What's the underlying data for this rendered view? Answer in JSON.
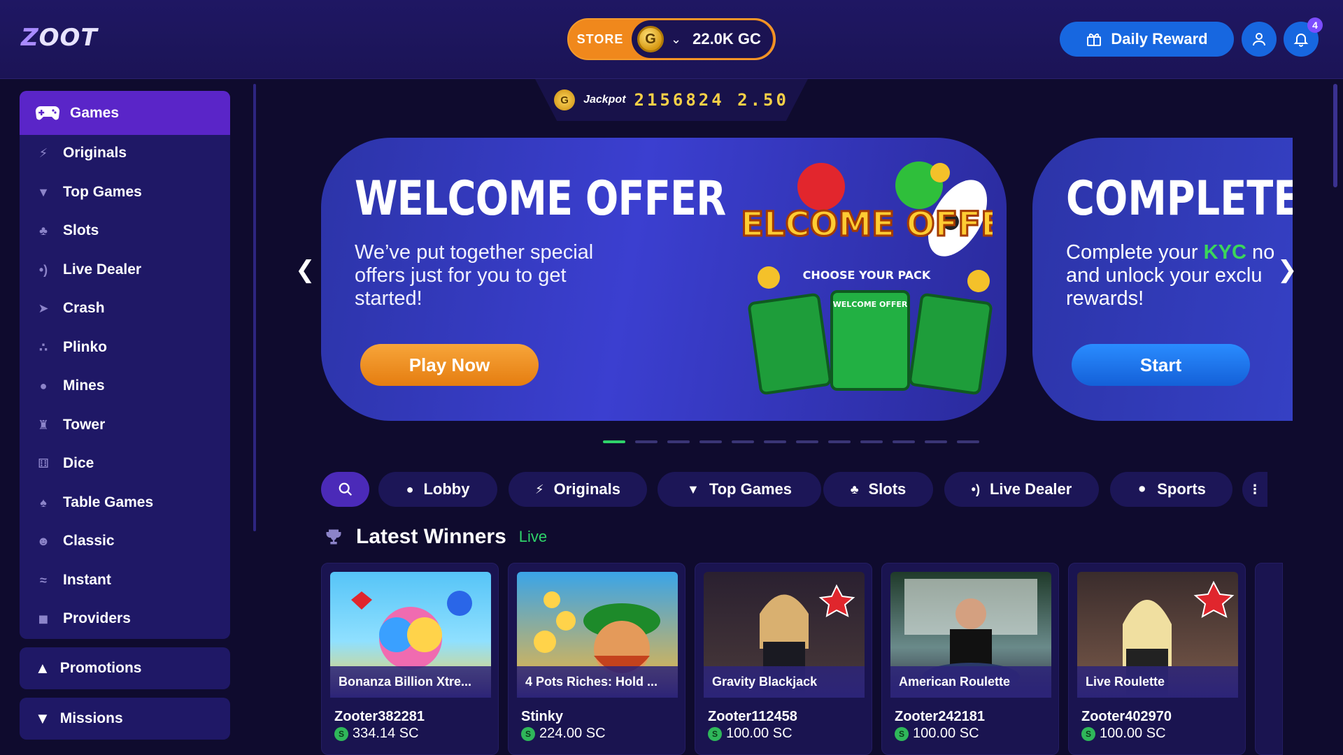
{
  "header": {
    "logo": "ZOOT",
    "store_label": "STORE",
    "balance": "22.0K GC",
    "coin_symbol": "G",
    "daily_reward_label": "Daily Reward",
    "notification_count": "4"
  },
  "jackpot": {
    "label": "Jackpot",
    "value": "2156824 2.50",
    "coin_symbol": "G"
  },
  "sidebar": {
    "games_label": "Games",
    "items": [
      {
        "label": "Originals",
        "icon": "bolt-icon"
      },
      {
        "label": "Top Games",
        "icon": "trophy-icon"
      },
      {
        "label": "Slots",
        "icon": "cherries-icon"
      },
      {
        "label": "Live Dealer",
        "icon": "broadcast-icon"
      },
      {
        "label": "Crash",
        "icon": "rocket-icon"
      },
      {
        "label": "Plinko",
        "icon": "plinko-icon"
      },
      {
        "label": "Mines",
        "icon": "bomb-icon"
      },
      {
        "label": "Tower",
        "icon": "tower-icon"
      },
      {
        "label": "Dice",
        "icon": "dice-icon"
      },
      {
        "label": "Table Games",
        "icon": "cards-icon"
      },
      {
        "label": "Classic",
        "icon": "classic-icon"
      },
      {
        "label": "Instant",
        "icon": "instant-icon"
      },
      {
        "label": "Providers",
        "icon": "cube-icon"
      }
    ],
    "promotions_label": "Promotions",
    "missions_label": "Missions"
  },
  "banners": [
    {
      "title": "WELCOME OFFER",
      "text": "We’ve put together special offers just for you to get started!",
      "button": "Play Now",
      "art_title": "WELCOME OFFER",
      "art_subtitle": "CHOOSE YOUR PACK",
      "card_label": "WELCOME OFFER"
    },
    {
      "title": "COMPLETE K",
      "text_before": "Complete your ",
      "text_highlight": "KYC",
      "text_after": " no",
      "text_line2": "and unlock your exclu",
      "text_line3": "rewards!",
      "button": "Start"
    }
  ],
  "categories": [
    {
      "label": "Lobby",
      "icon": "gamepad-icon"
    },
    {
      "label": "Originals",
      "icon": "bolt-icon"
    },
    {
      "label": "Top Games",
      "icon": "trophy-icon"
    },
    {
      "label": "Slots",
      "icon": "cherries-icon"
    },
    {
      "label": "Live Dealer",
      "icon": "broadcast-icon"
    },
    {
      "label": "Sports",
      "icon": "ball-icon"
    }
  ],
  "latest_winners": {
    "title": "Latest Winners",
    "live_label": "Live",
    "cards": [
      {
        "game": "Bonanza Billion Xtre...",
        "player": "Zooter382281",
        "amount": "334.14 SC"
      },
      {
        "game": "4 Pots Riches: Hold ...",
        "player": "Stinky",
        "amount": "224.00 SC"
      },
      {
        "game": "Gravity Blackjack",
        "player": "Zooter112458",
        "amount": "100.00 SC"
      },
      {
        "game": "American Roulette",
        "player": "Zooter242181",
        "amount": "100.00 SC"
      },
      {
        "game": "Live Roulette",
        "player": "Zooter402970",
        "amount": "100.00 SC"
      }
    ],
    "sc_symbol": "S"
  },
  "colors": {
    "background": "#0f0b2e",
    "accent_purple": "#5a25c8",
    "accent_orange": "#f0881c",
    "accent_blue": "#1767e0",
    "live_green": "#2fd36a",
    "jackpot_gold": "#f7d047"
  }
}
